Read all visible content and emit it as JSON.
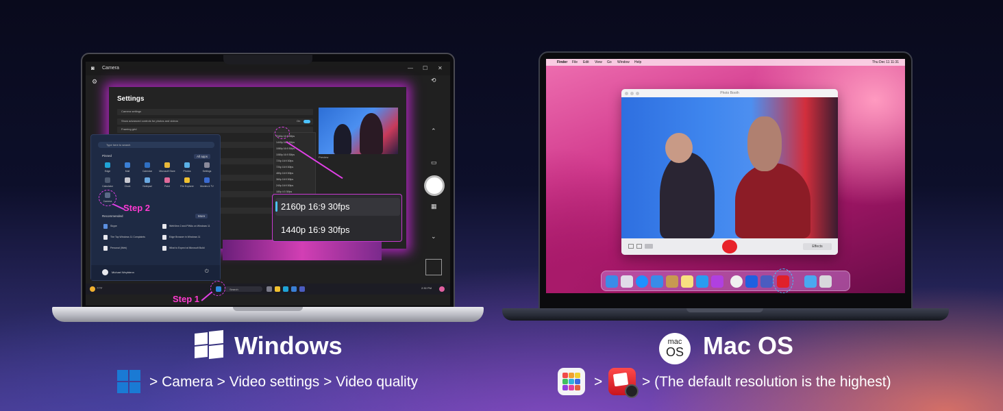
{
  "windows": {
    "title": "Windows",
    "path": "> Camera > Video settings > Video quality",
    "app_title": "Camera",
    "settings_title": "Settings",
    "settings_rows": [
      "Camera settings",
      "Show advanced controls for photos and videos",
      "Framing grid",
      "",
      "",
      "",
      "",
      "",
      ""
    ],
    "toggle_label": "On",
    "resolution_list": [
      "2160p 16:9 30fps",
      "1440p 16:9 30fps",
      "1080p 16:9 30fps",
      "1080p 16:9 30fps",
      "720p 16:9 30fps",
      "720p 16:9 30fps",
      "480p 16:9 30fps",
      "360p 16:9 30fps",
      "240p 16:9 30fps",
      "180p 4:3 30fps"
    ],
    "preview_label": "Preview",
    "start_search_placeholder": "Type here to search",
    "pinned_label": "Pinned",
    "all_apps_label": "All apps",
    "pinned_apps": [
      "Edge",
      "Mail",
      "Calendar",
      "Microsoft Store",
      "Photos",
      "Settings",
      "Calculator",
      "Clock",
      "Notepad",
      "Paint",
      "File Explorer",
      "Movies & TV",
      "Camera"
    ],
    "recommended_label": "Recommended",
    "more_label": "More",
    "recommended_items": [
      "Skype",
      "WebView 2 and PWAs on Windows 11",
      "The Top Windows 11 Complaints",
      "Edge Browser in Windows 11",
      "Personal (Web)",
      "What to Expect at Microsoft Build"
    ],
    "user_name": "Michael Weybtenn",
    "taskbar_weather": "77°F",
    "taskbar_search": "Search",
    "taskbar_time": "2:30 PM",
    "step1": "Step 1",
    "step2": "Step 2",
    "callout_options": [
      "2160p 16:9 30fps",
      "1440p 16:9 30fps"
    ]
  },
  "mac": {
    "title": "Mac OS",
    "badge_top": "mac",
    "badge_bottom": "OS",
    "path_sep": ">",
    "path_tail": "> (The default resolution is the highest)",
    "menubar": [
      "Finder",
      "File",
      "Edit",
      "View",
      "Go",
      "Window",
      "Help"
    ],
    "menubar_clock": "Thu Dec 11  11:31",
    "photobooth_title": "Photo Booth",
    "effects_label": "Effects"
  },
  "colors": {
    "accent_magenta": "#e040e6",
    "step_label": "#ff3ad2",
    "win_blue": "#1a7ad4",
    "record_red": "#e8222a"
  },
  "icons": [
    "windows-logo-icon",
    "macos-badge-icon",
    "launchpad-icon",
    "photo-booth-icon",
    "shutter-button",
    "gear-icon",
    "record-button"
  ]
}
